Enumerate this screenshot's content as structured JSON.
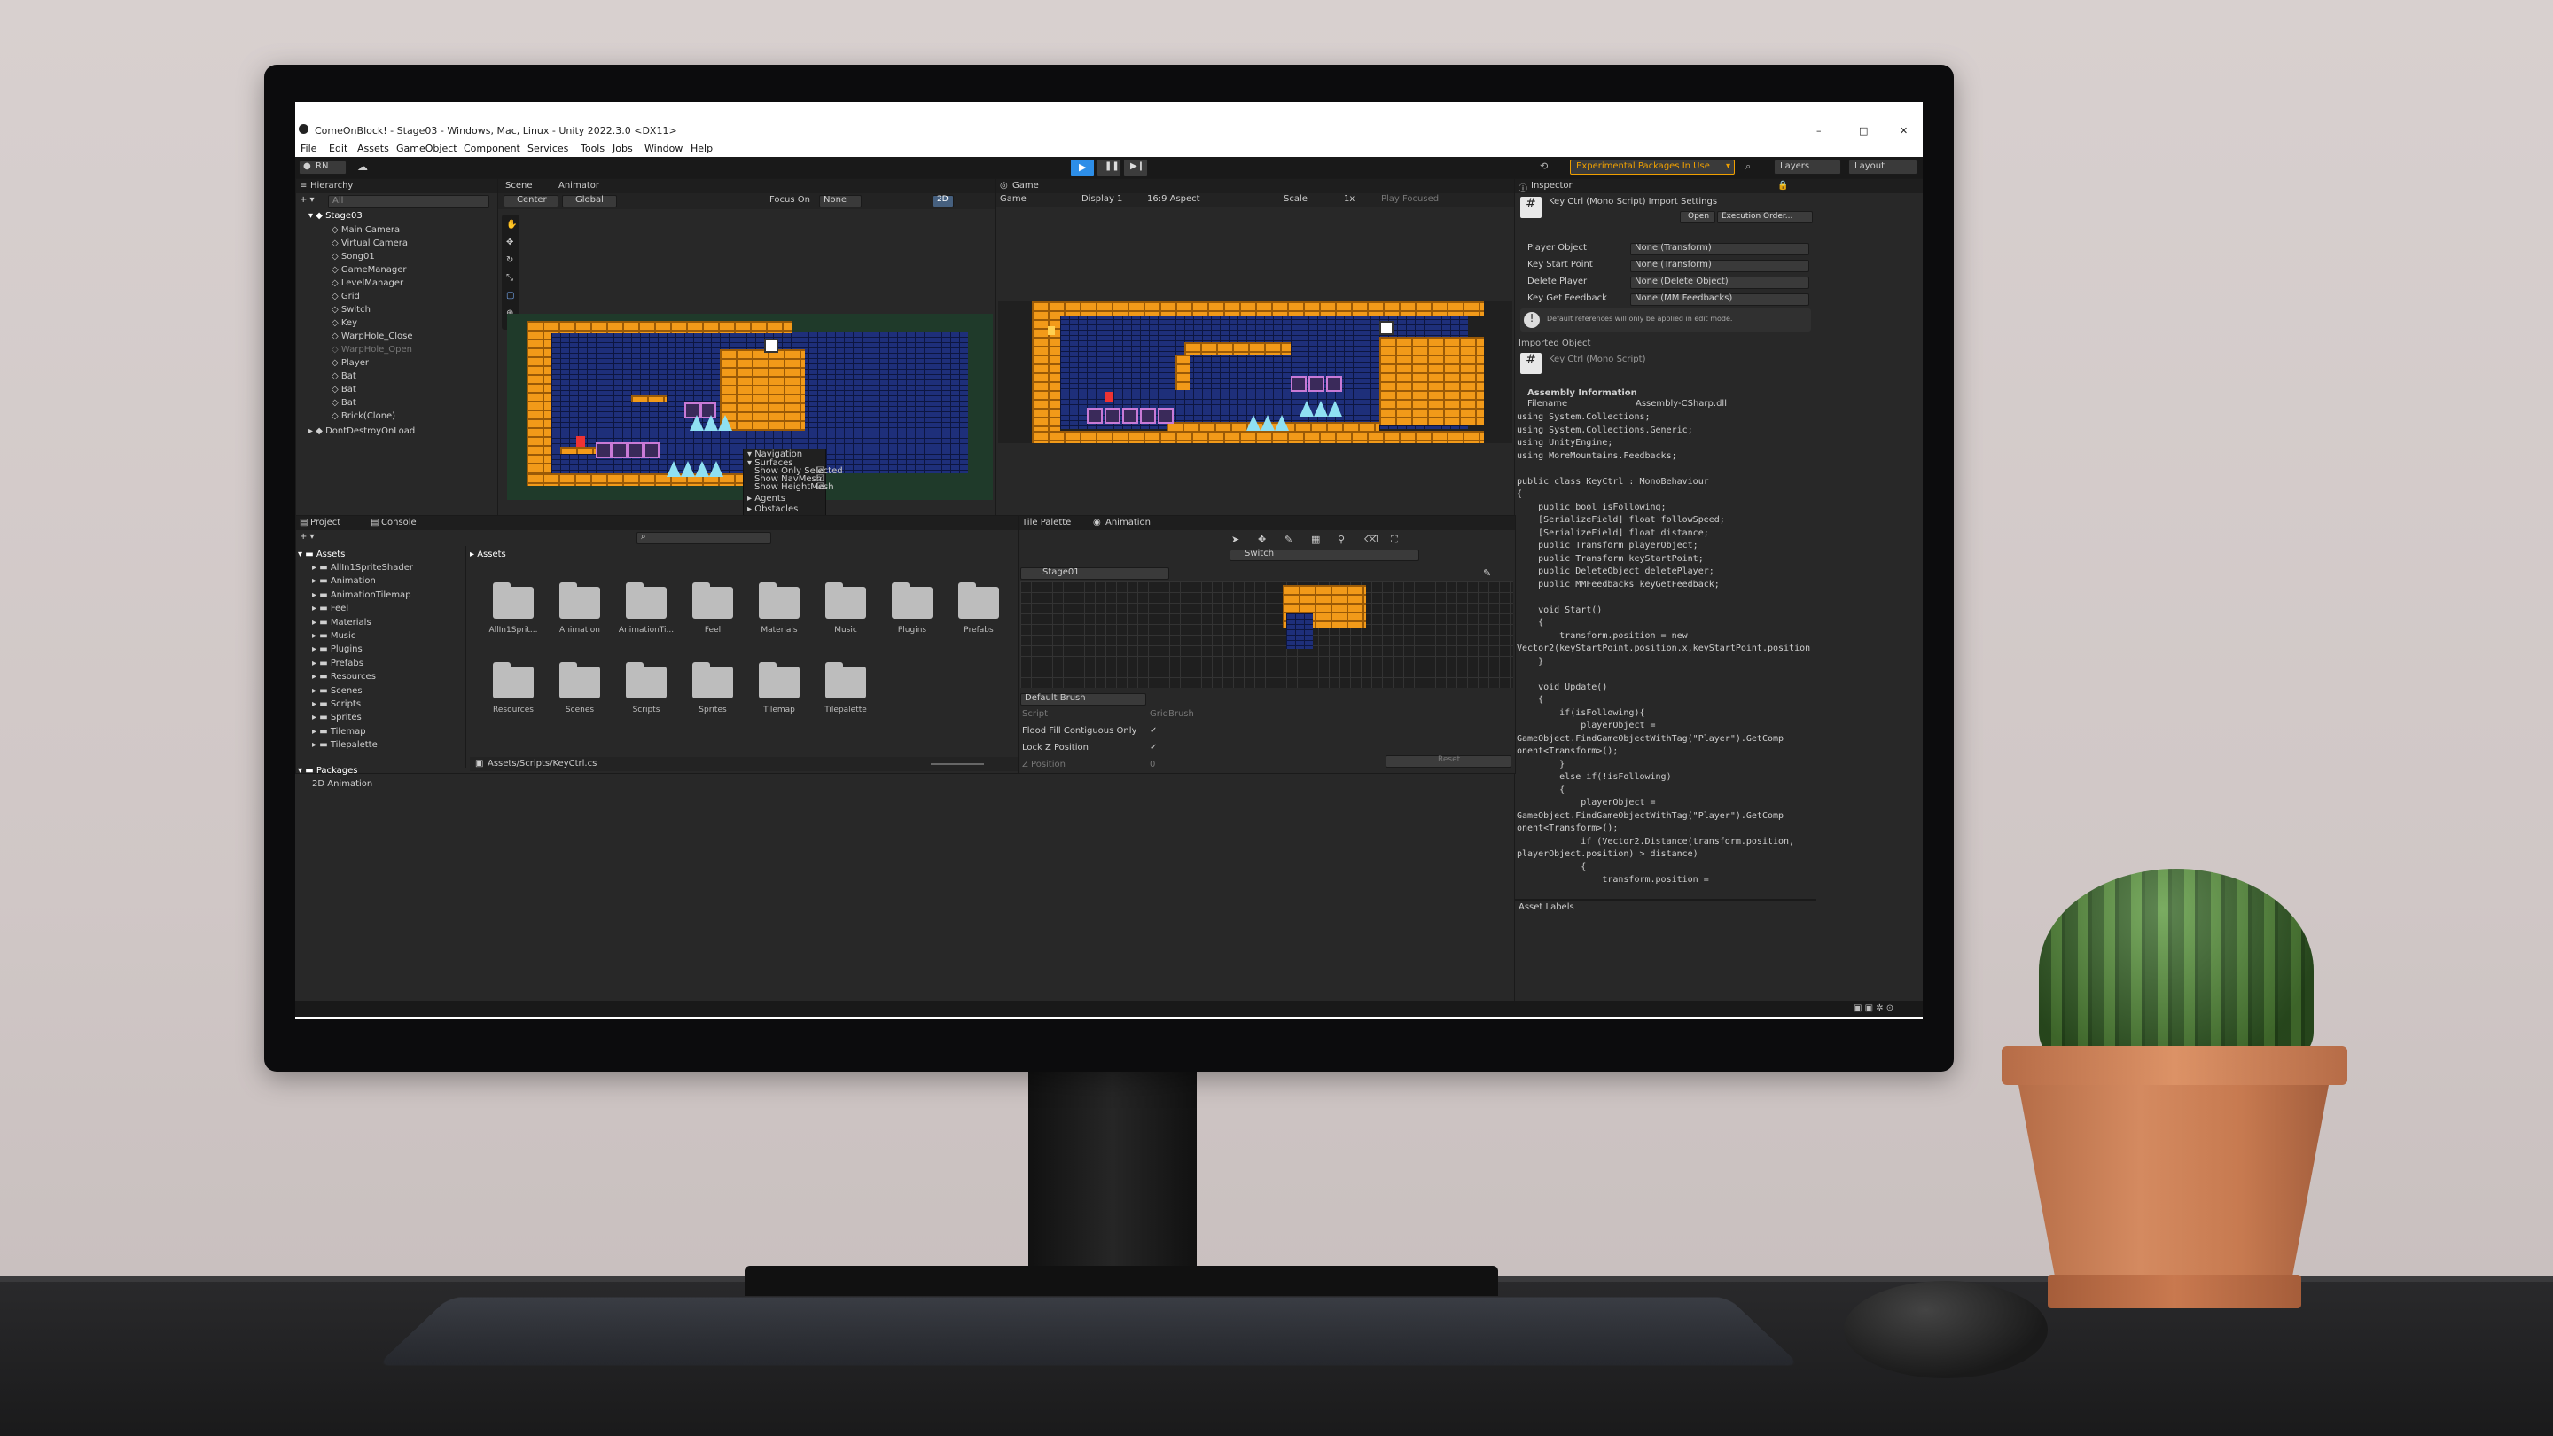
{
  "window": {
    "title": "ComeOnBlock! - Stage03 - Windows, Mac, Linux - Unity 2022.3.0 <DX11>",
    "controls": [
      "–",
      "□",
      "✕"
    ]
  },
  "menu": [
    "File",
    "Edit",
    "Assets",
    "GameObject",
    "Component",
    "Services",
    "Tools",
    "Jobs",
    "Window",
    "Help"
  ],
  "toolbar": {
    "account": "RN",
    "packages_warning": "Experimental Packages In Use",
    "layers": "Layers",
    "layout": "Layout"
  },
  "hierarchy": {
    "tab": "Hierarchy",
    "search_placeholder": "All",
    "scene": "Stage03",
    "items": [
      "Main Camera",
      "Virtual Camera",
      "Song01",
      "GameManager",
      "LevelManager",
      "Grid",
      "Switch",
      "Key",
      "WarpHole_Close",
      "WarpHole_Open",
      "Player",
      "Bat",
      "Bat",
      "Bat",
      "Brick(Clone)"
    ],
    "dont_destroy": "DontDestroyOnLoad"
  },
  "scene_view": {
    "tabs": [
      "Scene",
      "Animator"
    ],
    "pivot": "Center",
    "space": "Global",
    "focus_on": "Focus On",
    "focus_value": "None",
    "mode_2d": "2D",
    "nav_overlay": {
      "title": "Navigation",
      "surfaces": "Surfaces",
      "options": [
        "Show Only Selected",
        "Show NavMesh",
        "Show HeightMesh"
      ],
      "agents": "Agents",
      "obstacles": "Obstacles"
    }
  },
  "game_view": {
    "tab": "Game",
    "mode": "Game",
    "display": "Display 1",
    "aspect": "16:9 Aspect",
    "scale_label": "Scale",
    "scale_value": "1x",
    "play_focused": "Play Focused"
  },
  "inspector": {
    "tab": "Inspector",
    "header": "Key Ctrl (Mono Script) Import Settings",
    "open_btn": "Open",
    "exec_btn": "Execution Order...",
    "fields": [
      {
        "label": "Player Object",
        "value": "None (Transform)"
      },
      {
        "label": "Key Start Point",
        "value": "None (Transform)"
      },
      {
        "label": "Delete Player",
        "value": "None (Delete Object)"
      },
      {
        "label": "Key Get Feedback",
        "value": "None (MM Feedbacks)"
      }
    ],
    "info": "Default references will only be applied in edit mode.",
    "imported_object": "Imported Object",
    "script_name": "Key Ctrl (Mono Script)",
    "assembly_info": "Assembly Information",
    "filename_label": "Filename",
    "filename_value": "Assembly-CSharp.dll",
    "code": "using System.Collections;\nusing System.Collections.Generic;\nusing UnityEngine;\nusing MoreMountains.Feedbacks;\n\npublic class KeyCtrl : MonoBehaviour\n{\n    public bool isFollowing;\n    [SerializeField] float followSpeed;\n    [SerializeField] float distance;\n    public Transform playerObject;\n    public Transform keyStartPoint;\n    public DeleteObject deletePlayer;\n    public MMFeedbacks keyGetFeedback;\n\n    void Start()\n    {\n        transform.position = new\nVector2(keyStartPoint.position.x,keyStartPoint.position.y);\n    }\n\n    void Update()\n    {\n        if(isFollowing){\n            playerObject =\nGameObject.FindGameObjectWithTag(\"Player\").GetComp\nonent<Transform>();\n        }\n        else if(!isFollowing)\n        {\n            playerObject =\nGameObject.FindGameObjectWithTag(\"Player\").GetComp\nonent<Transform>();\n            if (Vector2.Distance(transform.position,\nplayerObject.position) > distance)\n            {\n                transform.position =",
    "asset_labels": "Asset Labels"
  },
  "project": {
    "tabs": [
      "Project",
      "Console"
    ],
    "tree_root": "Assets",
    "tree": [
      "AllIn1SpriteShader",
      "Animation",
      "AnimationTilemap",
      "Feel",
      "Materials",
      "Music",
      "Plugins",
      "Prefabs",
      "Resources",
      "Scenes",
      "Scripts",
      "Sprites",
      "Tilemap",
      "Tilepalette"
    ],
    "packages": "Packages",
    "packages_child": "2D Animation",
    "breadcrumb": "Assets",
    "folders": [
      "AllIn1Sprit...",
      "Animation",
      "AnimationTi...",
      "Feel",
      "Materials",
      "Music",
      "Plugins",
      "Prefabs",
      "Resources",
      "Scenes",
      "Scripts",
      "Sprites",
      "Tilemap",
      "Tilepalette"
    ],
    "path": "Assets/Scripts/KeyCtrl.cs"
  },
  "tile_palette": {
    "tabs": [
      "Tile Palette",
      "Animation"
    ],
    "target": "Switch",
    "palette": "Stage01",
    "brush": "Default Brush",
    "rows": [
      {
        "label": "Script",
        "value": "GridBrush"
      },
      {
        "label": "Flood Fill Contiguous Only",
        "value": "✓"
      },
      {
        "label": "Lock Z Position",
        "value": "✓"
      },
      {
        "label": "Z Position",
        "value": "0"
      }
    ],
    "reset": "Reset"
  },
  "colors": {
    "editor_bg": "#282828",
    "brick": "#f29a19",
    "wall": "#1e2f7a",
    "spike": "#8fe0f2",
    "warning": "#f0a000",
    "play_accent": "#2d8ee8"
  }
}
